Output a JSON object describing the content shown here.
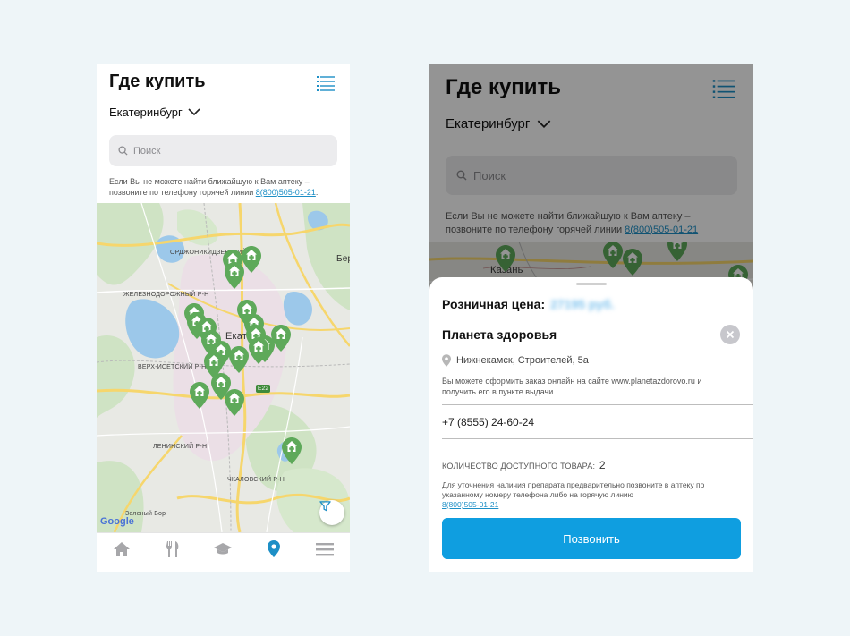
{
  "left": {
    "title": "Где купить",
    "city": "Екатеринбург",
    "search_placeholder": "Поиск",
    "hint_text": "Если Вы не можете найти ближайшую к Вам аптеку – позвоните по телефону горячей линии",
    "hotline": "8(800)505-01-21",
    "map_labels": [
      "ОРДЖОНИКИДЗЕВСКИЙ Р-Н",
      "ЖЕЛЕЗНОДОРОЖНЫЙ Р-Н",
      "ВЕРХ-ИСЕТСКИЙ Р-Н",
      "ЛЕНИНСКИЙ Р-Н",
      "ЧКАЛОВСКИЙ Р-Н",
      "Екатер",
      "Бер",
      "Зеленый Бор",
      "E22"
    ],
    "google_logo": "Google",
    "nav": [
      "home-icon",
      "fork-knife-icon",
      "graduation-cap-icon",
      "location-pin-icon",
      "menu-icon"
    ],
    "active_nav": "location-pin-icon"
  },
  "right": {
    "title": "Где купить",
    "city": "Екатеринбург",
    "search_placeholder": "Поиск",
    "hint_text": "Если Вы не можете найти ближайшую к Вам аптеку – позвоните по телефону горячей линии",
    "hotline": "8(800)505-01-21",
    "map_label": "Казань",
    "sheet": {
      "price_label": "Розничная цена:",
      "price_value": "27195 руб.",
      "shop_name": "Планета здоровья",
      "address": "Нижнекамск, Строителей, 5а",
      "order_note": "Вы можете оформить заказ онлайн на сайте www.planetazdorovo.ru и получить его в пункте выдачи",
      "phone": "+7 (8555) 24-60-24",
      "qty_label": "КОЛИЧЕСТВО ДОСТУПНОГО ТОВАРА:",
      "qty_value": "2",
      "availability_note": "Для уточнения наличия препарата предварительно позвоните в аптеку по указанному номеру телефона либо на горячую линию",
      "availability_hotline": "8(800)505-01-21",
      "call_button": "Позвонить"
    }
  },
  "colors": {
    "accent": "#0f9ee0",
    "pin_green": "#5ea95a",
    "link": "#1d8fc6"
  }
}
